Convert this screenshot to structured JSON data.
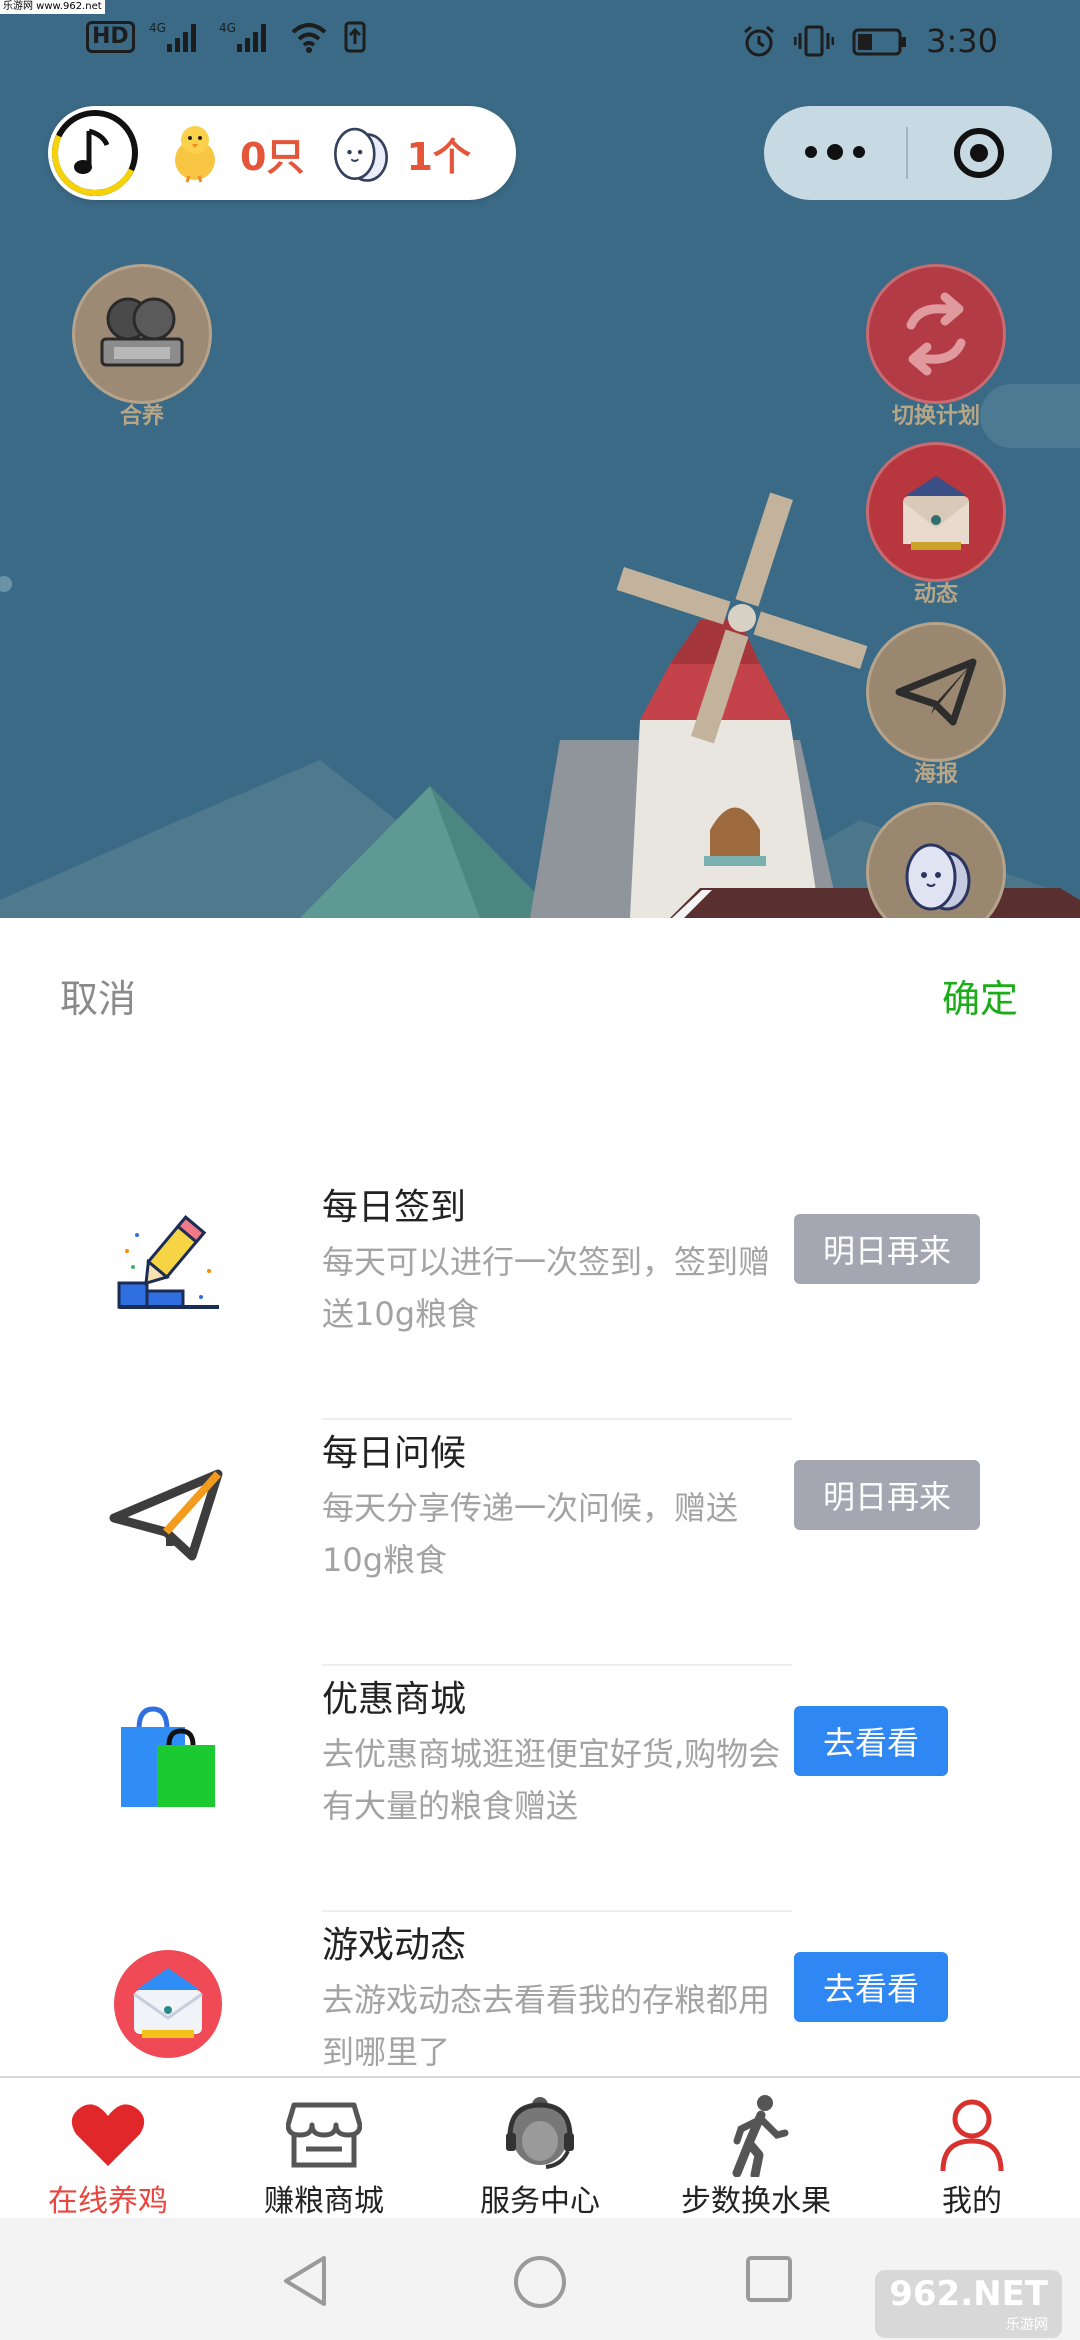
{
  "watermark": {
    "text": "乐游网 www.962.net"
  },
  "status_bar": {
    "hd": "HD",
    "net1": "4G",
    "net2": "4G",
    "time": "3:30"
  },
  "hud": {
    "chicks_count": "0只",
    "eggs_count": "1个"
  },
  "float_buttons": {
    "adopt": "合养",
    "switch_plan": "切换计划",
    "news": "动态",
    "poster": "海报"
  },
  "sheet": {
    "cancel": "取消",
    "confirm": "确定",
    "tasks": [
      {
        "title": "每日签到",
        "desc": "每天可以进行一次签到，签到赠送10g粮食",
        "action": "明日再来"
      },
      {
        "title": "每日问候",
        "desc": "每天分享传递一次问候，赠送10g粮食",
        "action": "明日再来"
      },
      {
        "title": "优惠商城",
        "desc": "去优惠商城逛逛便宜好货,购物会有大量的粮食赠送",
        "action": "去看看"
      },
      {
        "title": "游戏动态",
        "desc": "去游戏动态去看看我的存粮都用到哪里了",
        "action": "去看看"
      }
    ]
  },
  "tabbar": {
    "items": [
      {
        "label": "在线养鸡",
        "icon": "heart-icon",
        "active": true
      },
      {
        "label": "赚粮商城",
        "icon": "store-icon",
        "active": false
      },
      {
        "label": "服务中心",
        "icon": "headset-icon",
        "active": false
      },
      {
        "label": "步数换水果",
        "icon": "walking-icon",
        "active": false
      },
      {
        "label": "我的",
        "icon": "user-icon",
        "active": false
      }
    ]
  },
  "site_mark": {
    "main": "962.NET",
    "sub": "乐游网"
  },
  "colors": {
    "accent_green": "#1aad19",
    "accent_red": "#e8463e",
    "button_blue": "#2f87f4",
    "button_grey": "#a4a7b1",
    "scene_sky": "#3b6a86"
  }
}
